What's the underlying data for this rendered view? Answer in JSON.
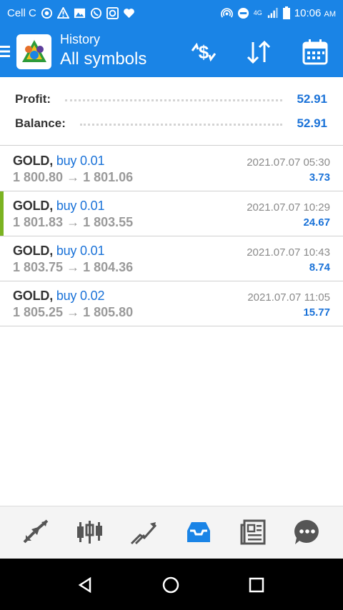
{
  "status_bar": {
    "carrier": "Cell C",
    "network": "4G",
    "time": "10:06",
    "ampm": "AM"
  },
  "header": {
    "section": "History",
    "filter": "All symbols"
  },
  "summary": {
    "profit_label": "Profit:",
    "profit_value": "52.91",
    "balance_label": "Balance:",
    "balance_value": "52.91"
  },
  "deals": [
    {
      "symbol": "GOLD,",
      "type": "buy 0.01",
      "prices": "1 800.80 → 1 801.06",
      "time": "2021.07.07 05:30",
      "profit": "3.73"
    },
    {
      "symbol": "GOLD,",
      "type": "buy 0.01",
      "prices": "1 801.83 → 1 803.55",
      "time": "2021.07.07 10:29",
      "profit": "24.67"
    },
    {
      "symbol": "GOLD,",
      "type": "buy 0.01",
      "prices": "1 803.75 → 1 804.36",
      "time": "2021.07.07 10:43",
      "profit": "8.74"
    },
    {
      "symbol": "GOLD,",
      "type": "buy 0.02",
      "prices": "1 805.25 → 1 805.80",
      "time": "2021.07.07 11:05",
      "profit": "15.77"
    }
  ],
  "bottom_nav": [
    {
      "icon": "quotes-icon",
      "active": false
    },
    {
      "icon": "chart-icon",
      "active": false
    },
    {
      "icon": "trade-icon",
      "active": false
    },
    {
      "icon": "history-icon",
      "active": true
    },
    {
      "icon": "news-icon",
      "active": false
    },
    {
      "icon": "chat-icon",
      "active": false
    }
  ],
  "colors": {
    "primary": "#1a84e6",
    "link_blue": "#1a72d8",
    "selected_marker": "#7bb321",
    "nav_icon": "#555555"
  }
}
